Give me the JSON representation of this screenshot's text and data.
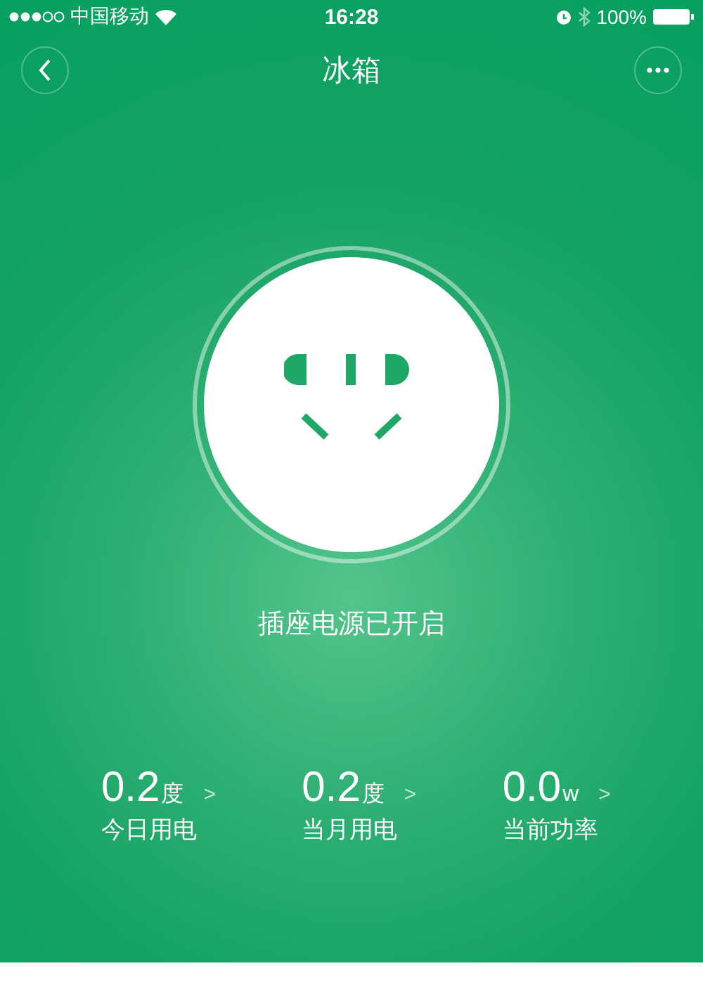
{
  "status_bar": {
    "carrier": "中国移动",
    "time": "16:28",
    "battery": "100%"
  },
  "nav": {
    "title": "冰箱"
  },
  "socket": {
    "on": true,
    "status": "插座电源已开启"
  },
  "stats": [
    {
      "value": "0.2",
      "unit": "度",
      "label": "今日用电",
      "arrow": ">"
    },
    {
      "value": "0.2",
      "unit": "度",
      "label": "当月用电",
      "arrow": ">"
    },
    {
      "value": "0.0",
      "unit": "w",
      "label": "当前功率",
      "arrow": ">"
    }
  ]
}
